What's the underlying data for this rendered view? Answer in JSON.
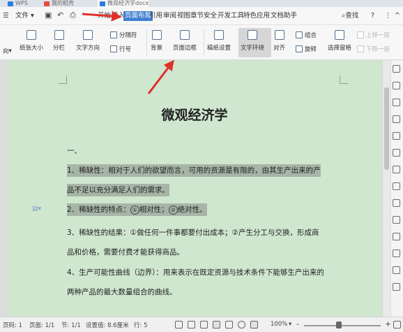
{
  "tabs": [
    {
      "label": "WPS",
      "color": "#2d7de0"
    },
    {
      "label": "我的稻壳",
      "color": "#e74c3c"
    },
    {
      "label": "微观经济学docx",
      "color": "#2d7de0"
    }
  ],
  "menu": {
    "file_label": "文件",
    "items": [
      "开始",
      "插入",
      "页面布局",
      "引用",
      "审阅",
      "视图",
      "章节",
      "安全",
      "开发工具",
      "特色应用",
      "文档助手"
    ],
    "active_index": 2,
    "search_label": "查找",
    "help_icon": "?",
    "more_icon": "⋮"
  },
  "ribbon": {
    "partial_label": "向",
    "buttons": [
      {
        "label": "纸张大小"
      },
      {
        "label": "分栏"
      },
      {
        "label": "文字方向"
      },
      {
        "label": "背景"
      },
      {
        "label": "页面边框"
      },
      {
        "label": "稿纸设置"
      },
      {
        "label": "文字环绕"
      },
      {
        "label": "对齐"
      },
      {
        "label": "选择窗格"
      }
    ],
    "small": [
      {
        "label": "分隔符"
      },
      {
        "label": "行号"
      },
      {
        "label": "组合"
      },
      {
        "label": "旋转"
      },
      {
        "label": "上移一层",
        "disabled": true
      },
      {
        "label": "下移一层",
        "disabled": true
      }
    ]
  },
  "document": {
    "title": "微观经济学",
    "section_marker": "一、",
    "p1_lines": [
      "1、稀缺性：相对于人们的欲望而言，可用的资源是有限的，由其生产出来的产",
      "品不足以充分满足人们的需求。"
    ],
    "p2_prefix": "2、稀缺性的特点：",
    "p2_c1": "①",
    "p2_t1": "相对性；",
    "p2_c2": "②",
    "p2_t2": "绝对性。",
    "p3_lines": [
      "3、稀缺性的结果：①做任何一件事都要付出成本；②产生分工与交换，形成商",
      "品和价格，需要付费才能获得商品。"
    ],
    "p4_lines": [
      "4、生产可能性曲线（边界）：用来表示在既定资源与技术条件下能够生产出来的",
      "两种产品的最大数量组合的曲线。"
    ]
  },
  "status": {
    "page_num": "页码: 1",
    "pages": "页面: 1/1",
    "section": "节: 1/1",
    "setting": "设置值: 8.6厘米",
    "line": "行: 5",
    "zoom": "100%",
    "zoom_minus": "-",
    "zoom_plus": "+",
    "zoom_level_percent": 45
  },
  "colors": {
    "page_bg": "#cfe7cf",
    "selection": "#a7b5a6",
    "active_tab": "#3f7fd0",
    "annotation_arrow": "#e0302a"
  }
}
